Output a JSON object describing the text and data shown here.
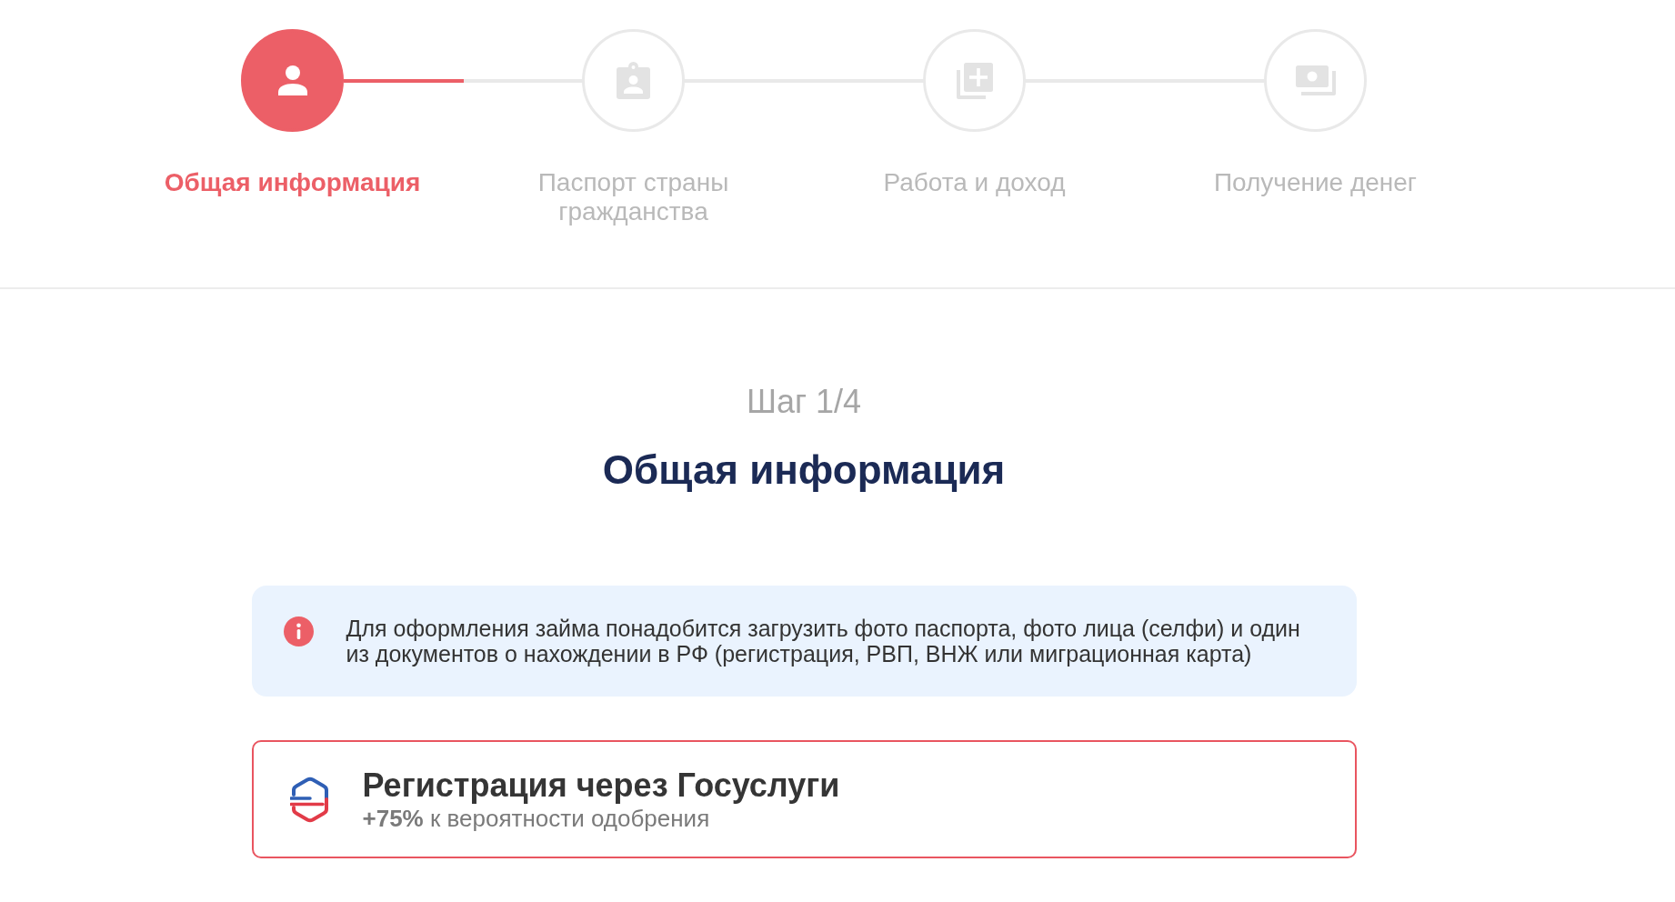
{
  "stepper": {
    "steps": [
      {
        "label": "Общая информация",
        "selected": true
      },
      {
        "label": "Паспорт страны гражданства",
        "selected": false
      },
      {
        "label": "Работа и доход",
        "selected": false
      },
      {
        "label": "Получение денег",
        "selected": false
      }
    ],
    "progress": {
      "level": 0.13
    }
  },
  "step_counter": "Шаг 1/4",
  "heading": "Общая информация",
  "notice": {
    "text": "Для оформления займа понадобится загрузить фото паспорта, фото лица (селфи) и один из документов о нахождении в РФ (регистрация, РВП, ВНЖ или миграционная карта)"
  },
  "registration_option": {
    "title": "Регистрация через Госуслуги",
    "subtitle": "**+75%** к вероятности одобрения"
  }
}
